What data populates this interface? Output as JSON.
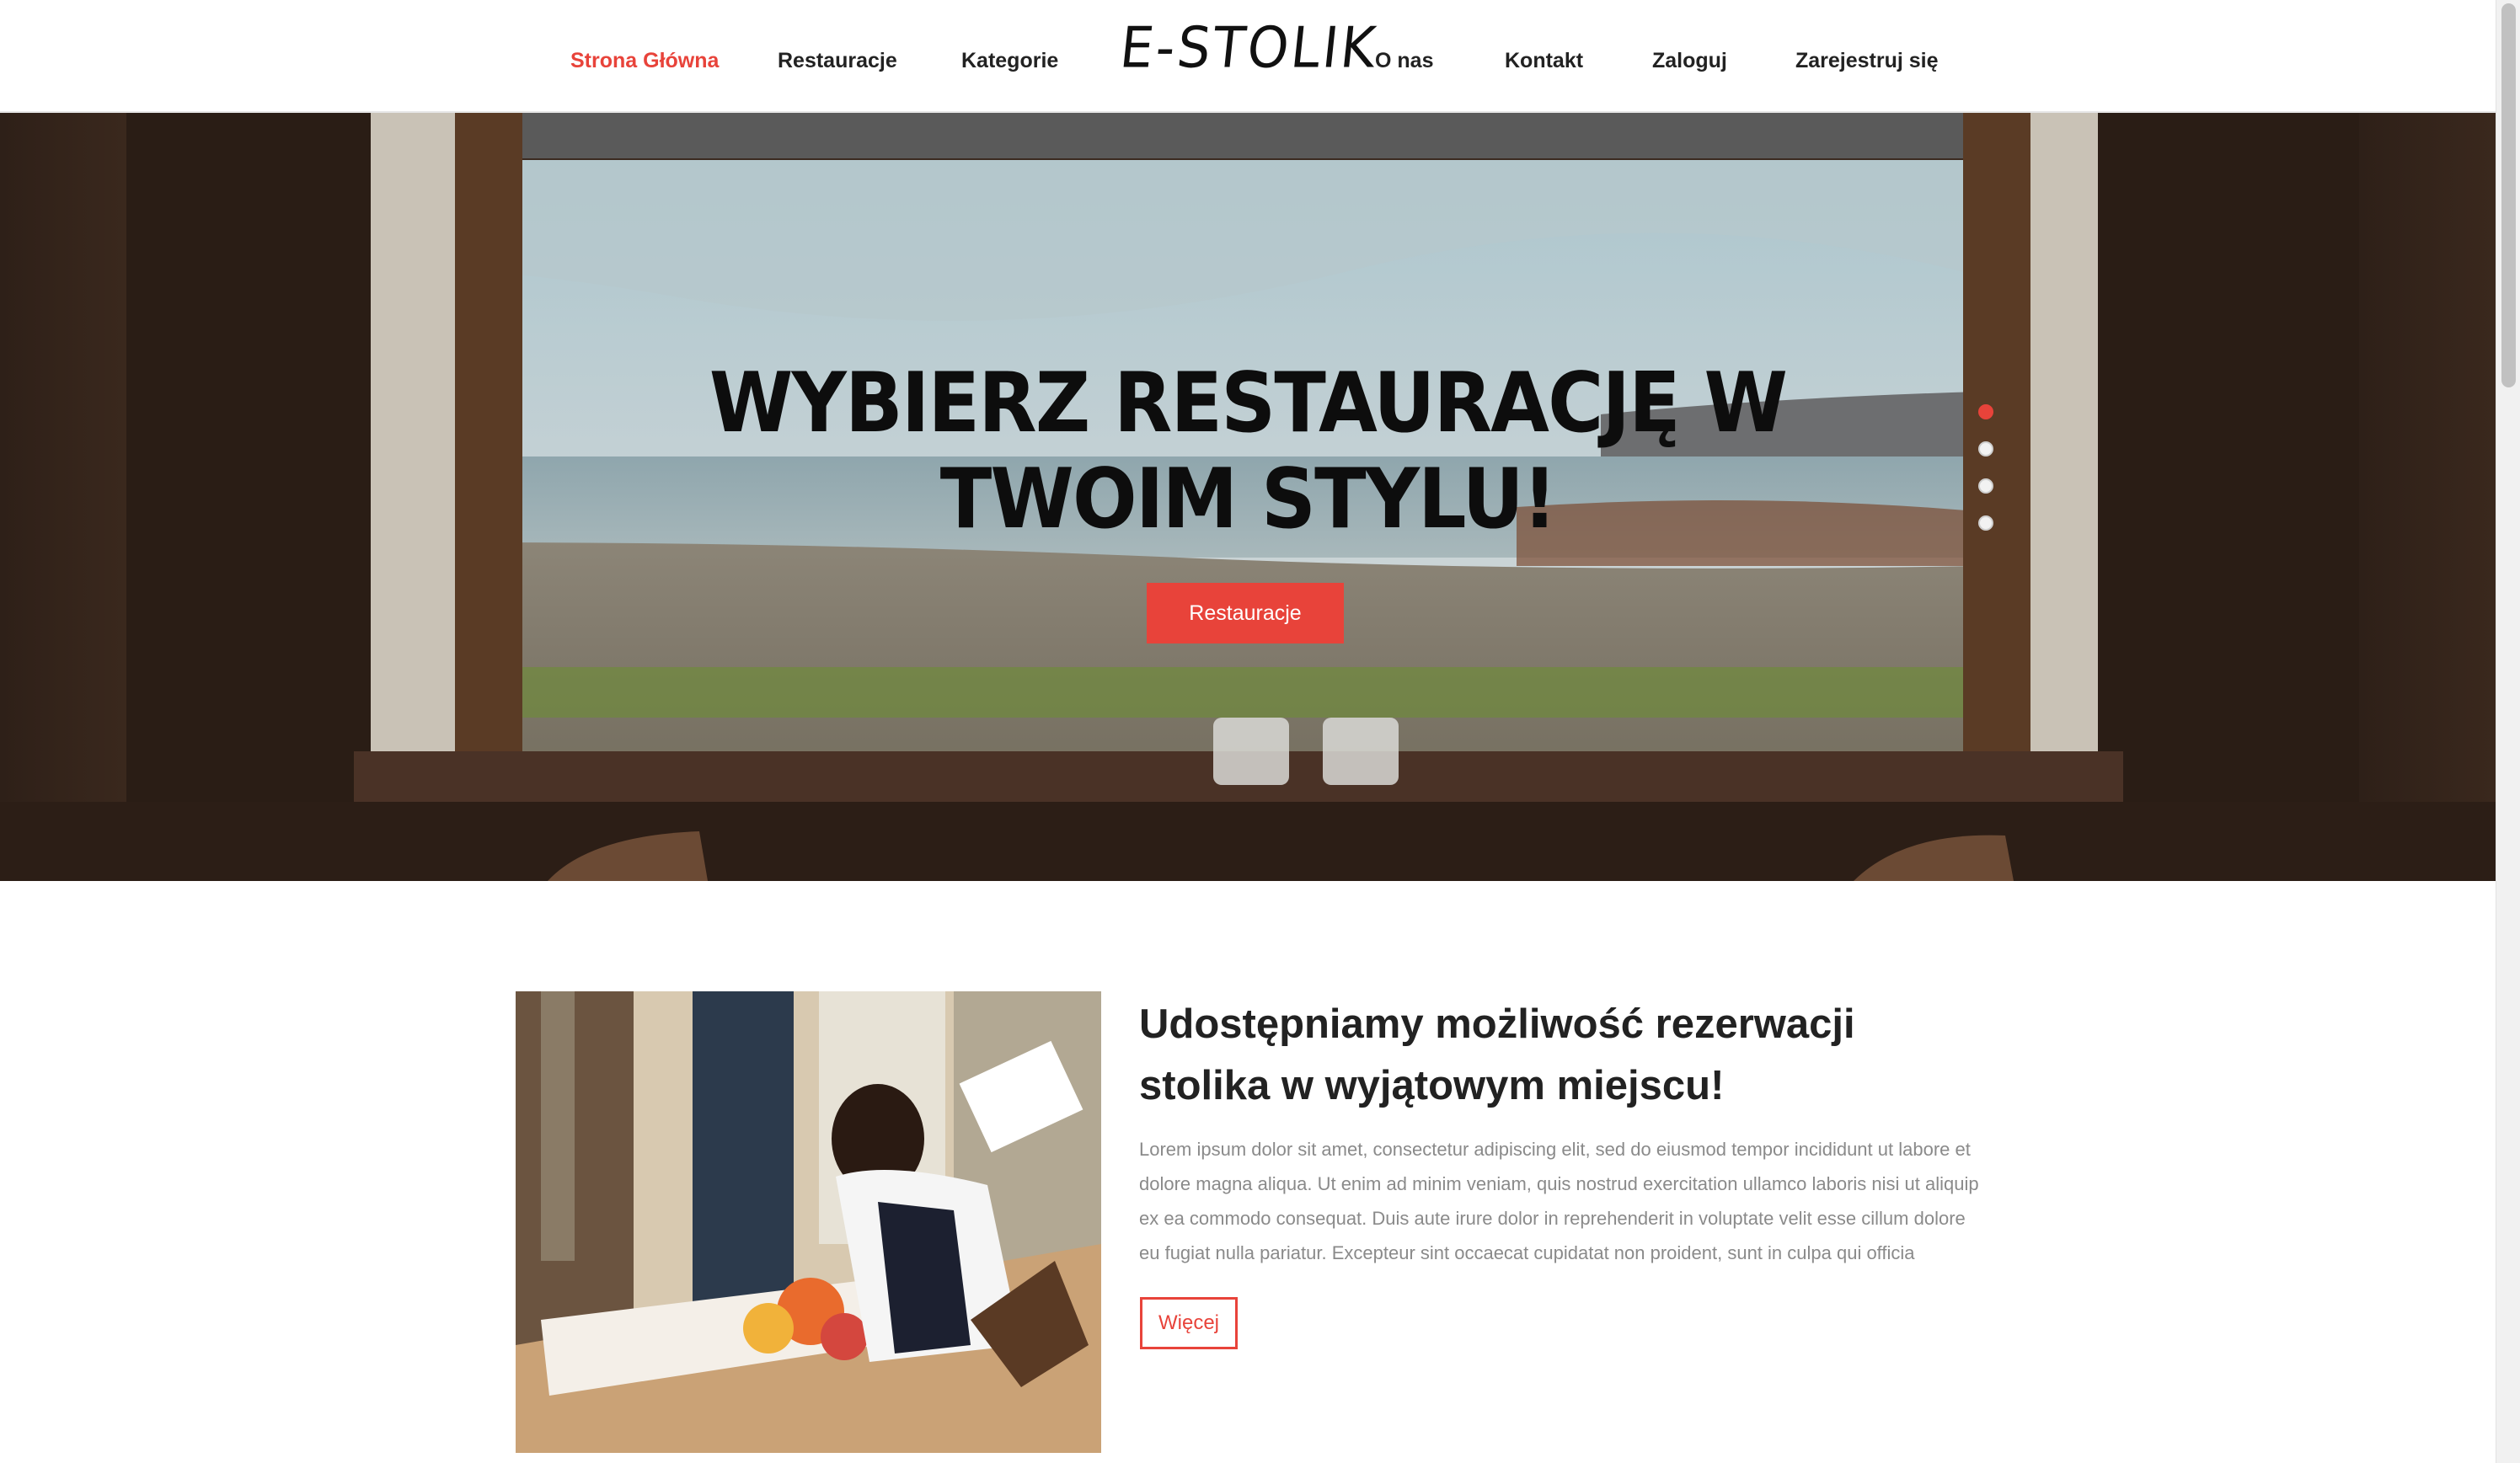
{
  "nav": {
    "left": [
      "Strona Główna",
      "Restauracje",
      "Kategorie"
    ],
    "logo": "E-STOLIK",
    "right": [
      "O nas",
      "Kontakt",
      "Zaloguj",
      "Zarejestruj się"
    ],
    "active_index": 0
  },
  "hero": {
    "title_line1": "WYBIERZ RESTAURACJĘ W",
    "title_line2": "TWOIM STYLU!",
    "button_label": "Restauracje",
    "slider_dots": 4,
    "active_dot": 0
  },
  "feature": {
    "title": "Udostępniamy możliwość rezerwacji stolika w wyjątowym miejscu!",
    "text": "Lorem ipsum dolor sit amet, consectetur adipiscing elit, sed do eiusmod tempor incididunt ut labore et dolore magna aliqua. Ut enim ad minim veniam, quis nostrud exercitation ullamco laboris nisi ut aliquip ex ea commodo consequat. Duis aute irure dolor in reprehenderit in voluptate velit esse cillum dolore eu fugiat nulla pariatur. Excepteur sint occaecat cupidatat non proident, sunt in culpa qui officia",
    "button_label": "Więcej"
  },
  "colors": {
    "accent": "#e8433a",
    "text_dark": "#222222",
    "text_muted": "#8a8a8a"
  }
}
